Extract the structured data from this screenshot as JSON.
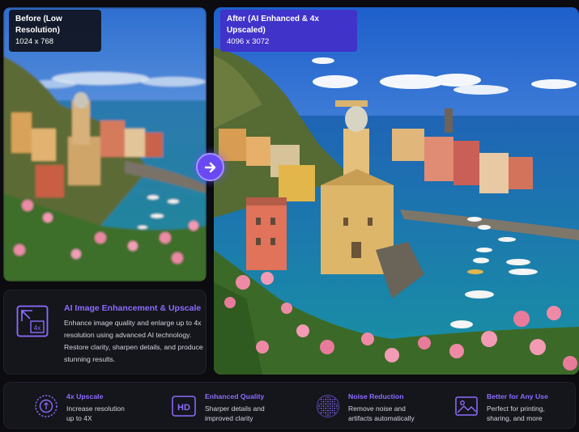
{
  "before": {
    "label": "Before (Low Resolution)",
    "resolution": "1024 x 768"
  },
  "after": {
    "label": "After (AI Enhanced & 4x Upscaled)",
    "resolution": "4096 x 3072"
  },
  "compare_button": {
    "icon": "arrow-right-icon"
  },
  "description": {
    "icon": "upscale-4x-icon",
    "icon_text": "4x",
    "title": "AI Image Enhancement & Upscale",
    "body": "Enhance image quality and enlarge up to 4x resolution using advanced AI technology. Restore clarity, sharpen details, and produce stunning results."
  },
  "features": [
    {
      "icon": "upscale-ring-icon",
      "title": "4x Upscale",
      "description": "Increase resolution up to 4X"
    },
    {
      "icon": "hd-icon",
      "icon_text": "HD",
      "title": "Enhanced Quality",
      "description": "Sharper details and improved clarity"
    },
    {
      "icon": "noise-dots-icon",
      "title": "Noise Reduction",
      "description": "Remove noise and artifacts automatically"
    },
    {
      "icon": "image-icon",
      "title": "Better for Any Use",
      "description": "Perfect for printing, sharing, and more"
    }
  ],
  "colors": {
    "accent": "#8c6dff",
    "button": "#6b49f2",
    "after_tag": "#4033c9",
    "background": "#0b0b10",
    "card": "#15151c"
  }
}
